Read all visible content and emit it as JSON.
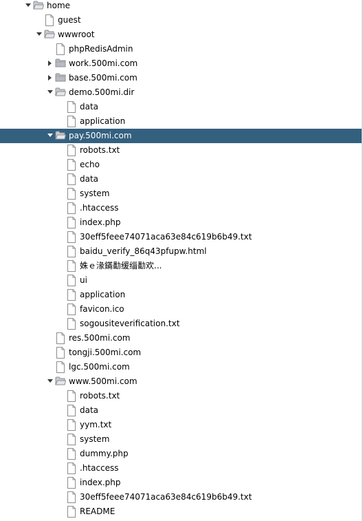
{
  "colors": {
    "selection_bg": "#34607f",
    "selection_text": "#ffffff",
    "text": "#000000",
    "folder_icon": "#8a8f94",
    "file_icon_border": "#8c8c8c"
  },
  "tree": {
    "nodes": [
      {
        "label": "home",
        "type": "folder",
        "depth": 0,
        "expanded": true
      },
      {
        "label": "guest",
        "type": "file",
        "depth": 1
      },
      {
        "label": "wwwroot",
        "type": "folder",
        "depth": 1,
        "expanded": true
      },
      {
        "label": "phpRedisAdmin",
        "type": "file",
        "depth": 2
      },
      {
        "label": "work.500mi.com",
        "type": "folder",
        "depth": 2,
        "expanded": false
      },
      {
        "label": "base.500mi.com",
        "type": "folder",
        "depth": 2,
        "expanded": false
      },
      {
        "label": "demo.500mi.dir",
        "type": "folder",
        "depth": 2,
        "expanded": true
      },
      {
        "label": "data",
        "type": "file",
        "depth": 3
      },
      {
        "label": "application",
        "type": "file",
        "depth": 3
      },
      {
        "label": "pay.500mi.com",
        "type": "folder",
        "depth": 2,
        "expanded": true,
        "selected": true
      },
      {
        "label": "robots.txt",
        "type": "file",
        "depth": 3
      },
      {
        "label": "echo",
        "type": "file",
        "depth": 3
      },
      {
        "label": "data",
        "type": "file",
        "depth": 3
      },
      {
        "label": "system",
        "type": "file",
        "depth": 3
      },
      {
        "label": ".htaccess",
        "type": "file",
        "depth": 3
      },
      {
        "label": "index.php",
        "type": "file",
        "depth": 3
      },
      {
        "label": "30eff5feee74071aca63e84c619b6b49.txt",
        "type": "file",
        "depth": 3
      },
      {
        "label": "baidu_verify_86q43pfupw.html",
        "type": "file",
        "depth": 3
      },
      {
        "label": "姝ｅ湪鏋勫缓缁勫欢...",
        "type": "file",
        "depth": 3
      },
      {
        "label": "ui",
        "type": "file",
        "depth": 3
      },
      {
        "label": "application",
        "type": "file",
        "depth": 3
      },
      {
        "label": "favicon.ico",
        "type": "file",
        "depth": 3
      },
      {
        "label": "sogousiteverification.txt",
        "type": "file",
        "depth": 3
      },
      {
        "label": "res.500mi.com",
        "type": "file",
        "depth": 2
      },
      {
        "label": "tongji.500mi.com",
        "type": "file",
        "depth": 2
      },
      {
        "label": "lgc.500mi.com",
        "type": "file",
        "depth": 2
      },
      {
        "label": "www.500mi.com",
        "type": "folder",
        "depth": 2,
        "expanded": true
      },
      {
        "label": "robots.txt",
        "type": "file",
        "depth": 3
      },
      {
        "label": "data",
        "type": "file",
        "depth": 3
      },
      {
        "label": "yym.txt",
        "type": "file",
        "depth": 3
      },
      {
        "label": "system",
        "type": "file",
        "depth": 3
      },
      {
        "label": "dummy.php",
        "type": "file",
        "depth": 3
      },
      {
        "label": ".htaccess",
        "type": "file",
        "depth": 3
      },
      {
        "label": "index.php",
        "type": "file",
        "depth": 3
      },
      {
        "label": "30eff5feee74071aca63e84c619b6b49.txt",
        "type": "file",
        "depth": 3
      },
      {
        "label": "README",
        "type": "file",
        "depth": 3
      }
    ]
  }
}
